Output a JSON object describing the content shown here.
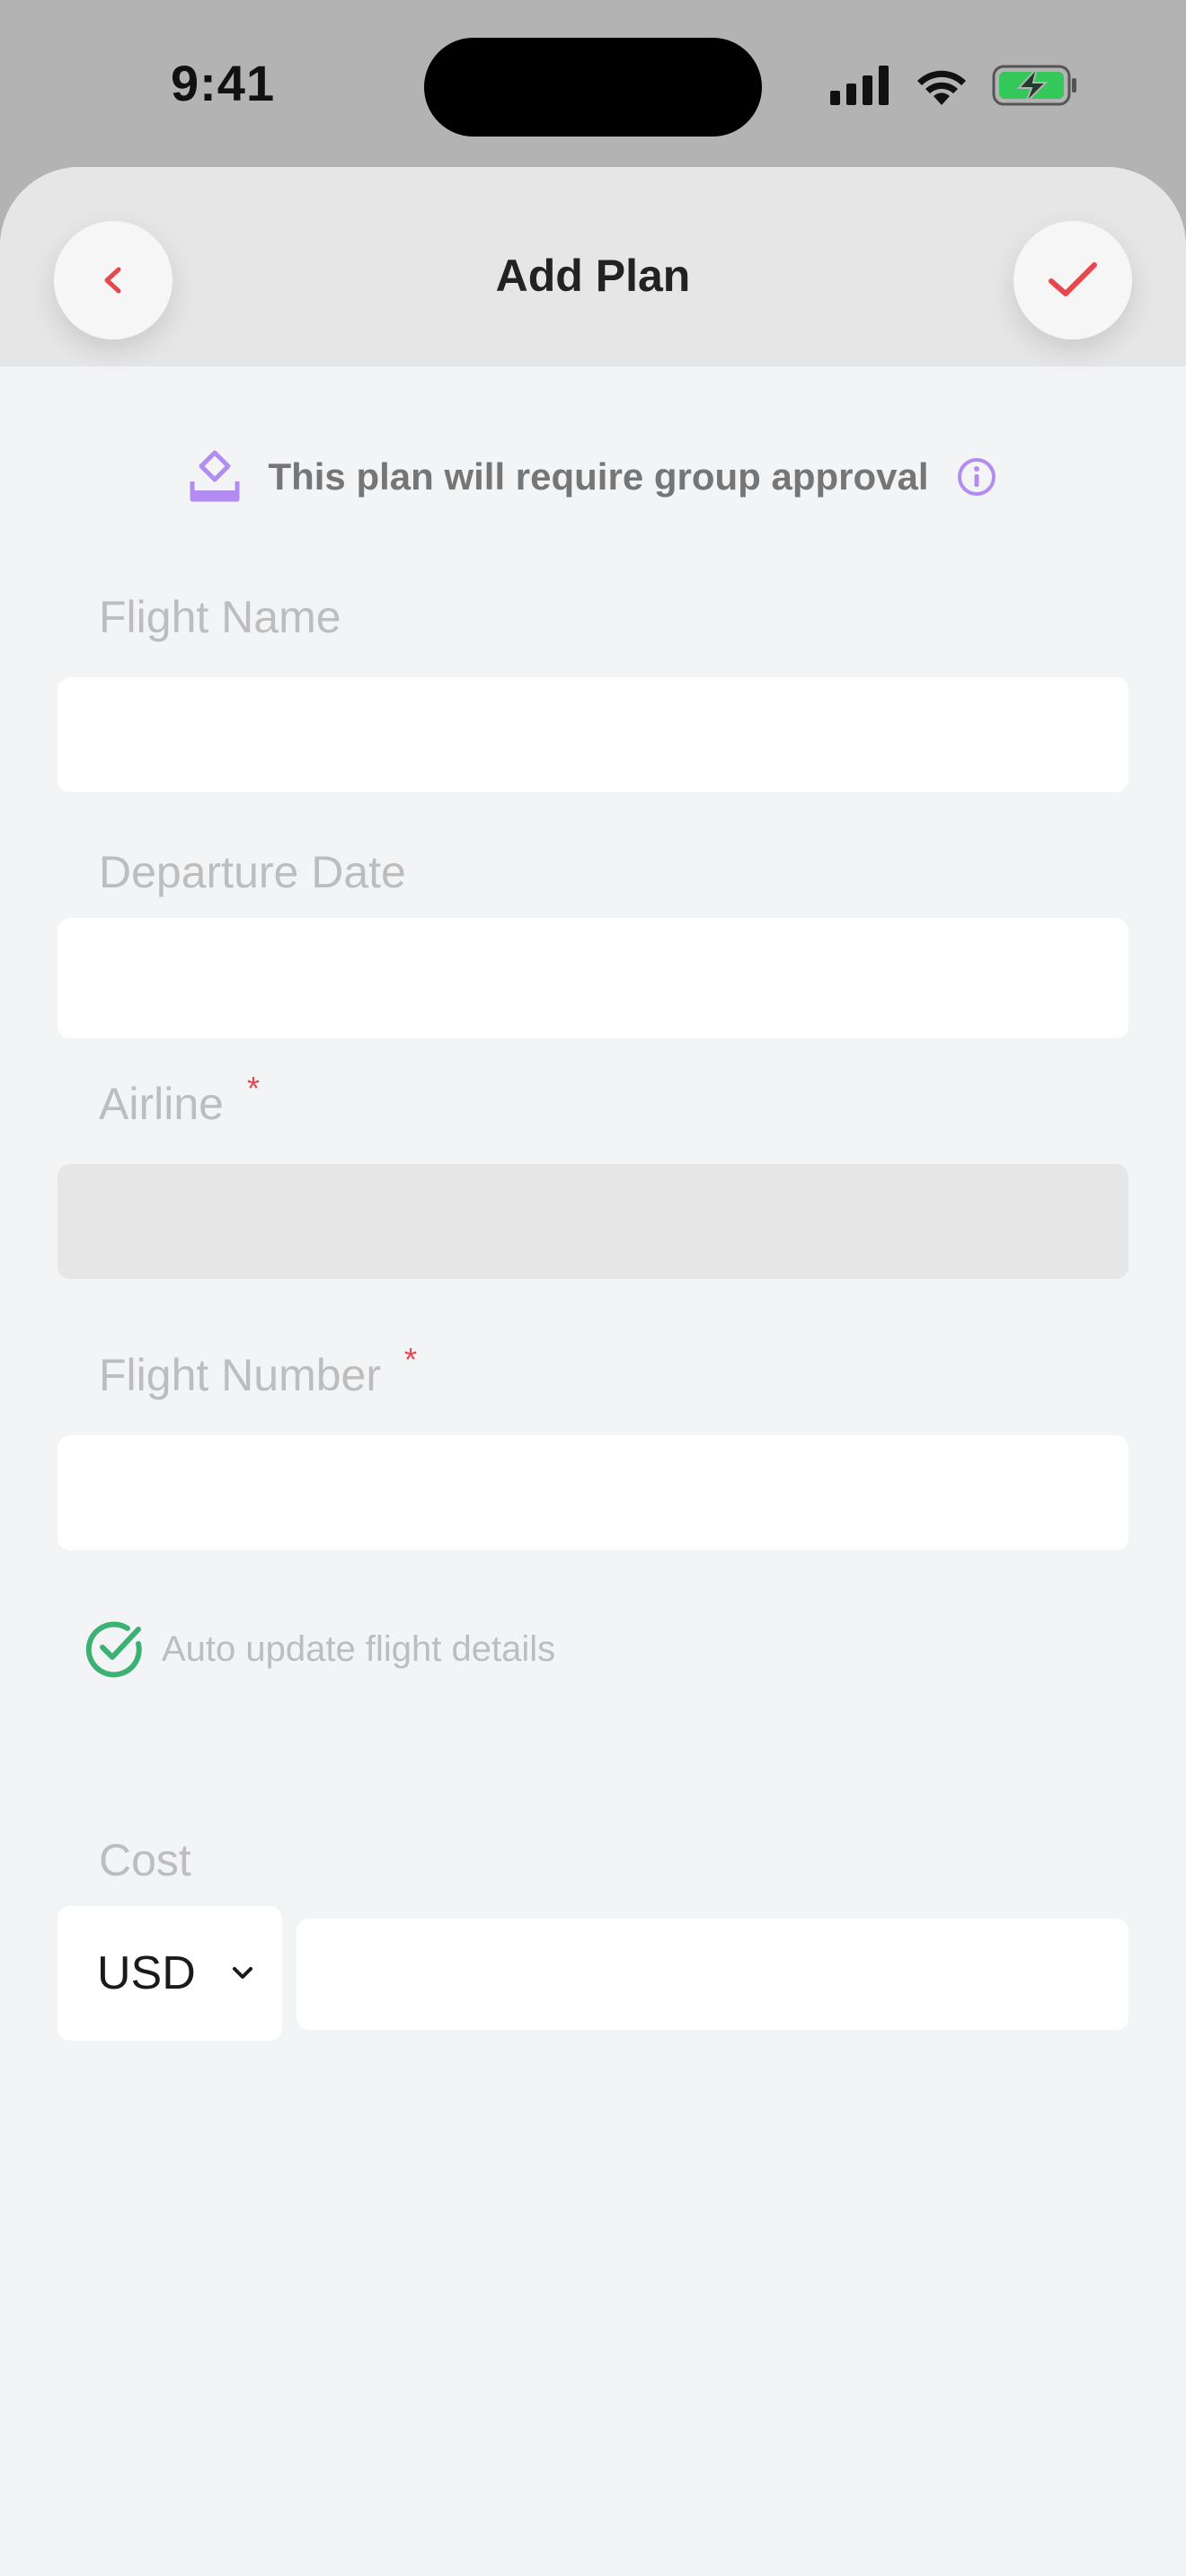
{
  "status_bar": {
    "time": "9:41"
  },
  "header": {
    "title": "Add Plan"
  },
  "notice": {
    "text": "This plan will require group approval"
  },
  "form": {
    "flight_name": {
      "label": "Flight Name",
      "value": ""
    },
    "departure_date": {
      "label": "Departure Date",
      "value": ""
    },
    "airline": {
      "label": "Airline",
      "required_mark": "*",
      "value": ""
    },
    "flight_number": {
      "label": "Flight Number",
      "required_mark": "*",
      "value": ""
    },
    "auto_update": {
      "label": "Auto update flight details",
      "checked": true
    },
    "cost": {
      "label": "Cost",
      "currency": "USD",
      "value": ""
    }
  },
  "colors": {
    "accent_red": "#e5484d",
    "approval_purple": "#b38cf2",
    "check_green": "#3bb273",
    "battery_green": "#34c759"
  }
}
